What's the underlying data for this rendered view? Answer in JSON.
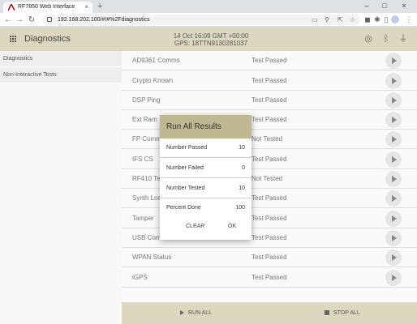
{
  "browser": {
    "tab_title": "RF7850 Web Interface",
    "tab_close": "×",
    "new_tab": "+",
    "url": "192.168.202.100/#!#%2Fdiagnostics",
    "win_min": "–",
    "win_max": "□",
    "win_close": "×",
    "nav_back": "←",
    "nav_forward": "→",
    "nav_reload": "↻"
  },
  "header": {
    "title": "Diagnostics",
    "datetime": "14 Oct 16:09 GMT +00:00",
    "gps": "GPS: 18TTN9130281037",
    "icons": [
      "wifi-tethering-icon",
      "bluetooth-icon",
      "power-plug-icon"
    ]
  },
  "sidebar": {
    "items": [
      {
        "label": "Diagnostics"
      },
      {
        "label": "Non-Interactive Tests"
      }
    ]
  },
  "tests": [
    {
      "name": "AD9361 Comms",
      "status": "Test Passed"
    },
    {
      "name": "Crypto Known",
      "status": "Test Passed"
    },
    {
      "name": "DSP Ping",
      "status": "Test Passed"
    },
    {
      "name": "Ext Ram",
      "status": "Test Passed"
    },
    {
      "name": "FP Comm",
      "status": "Not Tested"
    },
    {
      "name": "IFS CS",
      "status": "Test Passed"
    },
    {
      "name": "RF410 Te",
      "status": "Not Tested"
    },
    {
      "name": "Synth Loc",
      "status": "Test Passed"
    },
    {
      "name": "Tamper",
      "status": "Test Passed"
    },
    {
      "name": "USB Comms",
      "status": "Test Passed"
    },
    {
      "name": "WPAN Status",
      "status": "Test Passed"
    },
    {
      "name": "iGPS",
      "status": "Test Passed"
    }
  ],
  "footer": {
    "run_all": "RUN ALL",
    "stop_all": "STOP ALL"
  },
  "dialog": {
    "title": "Run All Results",
    "rows": [
      {
        "label": "Number Passed",
        "value": "10"
      },
      {
        "label": "Number Failed",
        "value": "0"
      },
      {
        "label": "Number Tested",
        "value": "10"
      },
      {
        "label": "Percent Done",
        "value": "100"
      }
    ],
    "clear_label": "CLEAR",
    "ok_label": "OK"
  },
  "colors": {
    "header_bg": "#dcd8c0",
    "dialog_title_bg": "#bfb891"
  }
}
